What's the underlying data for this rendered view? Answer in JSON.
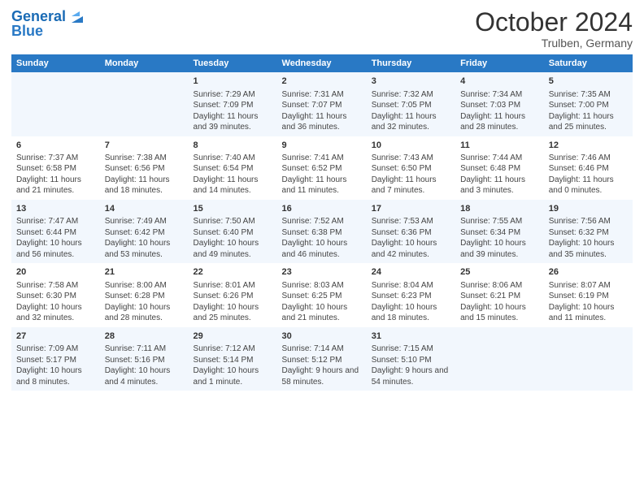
{
  "header": {
    "logo_line1": "General",
    "logo_line2": "Blue",
    "month": "October 2024",
    "location": "Trulben, Germany"
  },
  "weekdays": [
    "Sunday",
    "Monday",
    "Tuesday",
    "Wednesday",
    "Thursday",
    "Friday",
    "Saturday"
  ],
  "rows": [
    [
      {
        "day": "",
        "info": ""
      },
      {
        "day": "",
        "info": ""
      },
      {
        "day": "1",
        "info": "Sunrise: 7:29 AM\nSunset: 7:09 PM\nDaylight: 11 hours and 39 minutes."
      },
      {
        "day": "2",
        "info": "Sunrise: 7:31 AM\nSunset: 7:07 PM\nDaylight: 11 hours and 36 minutes."
      },
      {
        "day": "3",
        "info": "Sunrise: 7:32 AM\nSunset: 7:05 PM\nDaylight: 11 hours and 32 minutes."
      },
      {
        "day": "4",
        "info": "Sunrise: 7:34 AM\nSunset: 7:03 PM\nDaylight: 11 hours and 28 minutes."
      },
      {
        "day": "5",
        "info": "Sunrise: 7:35 AM\nSunset: 7:00 PM\nDaylight: 11 hours and 25 minutes."
      }
    ],
    [
      {
        "day": "6",
        "info": "Sunrise: 7:37 AM\nSunset: 6:58 PM\nDaylight: 11 hours and 21 minutes."
      },
      {
        "day": "7",
        "info": "Sunrise: 7:38 AM\nSunset: 6:56 PM\nDaylight: 11 hours and 18 minutes."
      },
      {
        "day": "8",
        "info": "Sunrise: 7:40 AM\nSunset: 6:54 PM\nDaylight: 11 hours and 14 minutes."
      },
      {
        "day": "9",
        "info": "Sunrise: 7:41 AM\nSunset: 6:52 PM\nDaylight: 11 hours and 11 minutes."
      },
      {
        "day": "10",
        "info": "Sunrise: 7:43 AM\nSunset: 6:50 PM\nDaylight: 11 hours and 7 minutes."
      },
      {
        "day": "11",
        "info": "Sunrise: 7:44 AM\nSunset: 6:48 PM\nDaylight: 11 hours and 3 minutes."
      },
      {
        "day": "12",
        "info": "Sunrise: 7:46 AM\nSunset: 6:46 PM\nDaylight: 11 hours and 0 minutes."
      }
    ],
    [
      {
        "day": "13",
        "info": "Sunrise: 7:47 AM\nSunset: 6:44 PM\nDaylight: 10 hours and 56 minutes."
      },
      {
        "day": "14",
        "info": "Sunrise: 7:49 AM\nSunset: 6:42 PM\nDaylight: 10 hours and 53 minutes."
      },
      {
        "day": "15",
        "info": "Sunrise: 7:50 AM\nSunset: 6:40 PM\nDaylight: 10 hours and 49 minutes."
      },
      {
        "day": "16",
        "info": "Sunrise: 7:52 AM\nSunset: 6:38 PM\nDaylight: 10 hours and 46 minutes."
      },
      {
        "day": "17",
        "info": "Sunrise: 7:53 AM\nSunset: 6:36 PM\nDaylight: 10 hours and 42 minutes."
      },
      {
        "day": "18",
        "info": "Sunrise: 7:55 AM\nSunset: 6:34 PM\nDaylight: 10 hours and 39 minutes."
      },
      {
        "day": "19",
        "info": "Sunrise: 7:56 AM\nSunset: 6:32 PM\nDaylight: 10 hours and 35 minutes."
      }
    ],
    [
      {
        "day": "20",
        "info": "Sunrise: 7:58 AM\nSunset: 6:30 PM\nDaylight: 10 hours and 32 minutes."
      },
      {
        "day": "21",
        "info": "Sunrise: 8:00 AM\nSunset: 6:28 PM\nDaylight: 10 hours and 28 minutes."
      },
      {
        "day": "22",
        "info": "Sunrise: 8:01 AM\nSunset: 6:26 PM\nDaylight: 10 hours and 25 minutes."
      },
      {
        "day": "23",
        "info": "Sunrise: 8:03 AM\nSunset: 6:25 PM\nDaylight: 10 hours and 21 minutes."
      },
      {
        "day": "24",
        "info": "Sunrise: 8:04 AM\nSunset: 6:23 PM\nDaylight: 10 hours and 18 minutes."
      },
      {
        "day": "25",
        "info": "Sunrise: 8:06 AM\nSunset: 6:21 PM\nDaylight: 10 hours and 15 minutes."
      },
      {
        "day": "26",
        "info": "Sunrise: 8:07 AM\nSunset: 6:19 PM\nDaylight: 10 hours and 11 minutes."
      }
    ],
    [
      {
        "day": "27",
        "info": "Sunrise: 7:09 AM\nSunset: 5:17 PM\nDaylight: 10 hours and 8 minutes."
      },
      {
        "day": "28",
        "info": "Sunrise: 7:11 AM\nSunset: 5:16 PM\nDaylight: 10 hours and 4 minutes."
      },
      {
        "day": "29",
        "info": "Sunrise: 7:12 AM\nSunset: 5:14 PM\nDaylight: 10 hours and 1 minute."
      },
      {
        "day": "30",
        "info": "Sunrise: 7:14 AM\nSunset: 5:12 PM\nDaylight: 9 hours and 58 minutes."
      },
      {
        "day": "31",
        "info": "Sunrise: 7:15 AM\nSunset: 5:10 PM\nDaylight: 9 hours and 54 minutes."
      },
      {
        "day": "",
        "info": ""
      },
      {
        "day": "",
        "info": ""
      }
    ]
  ]
}
